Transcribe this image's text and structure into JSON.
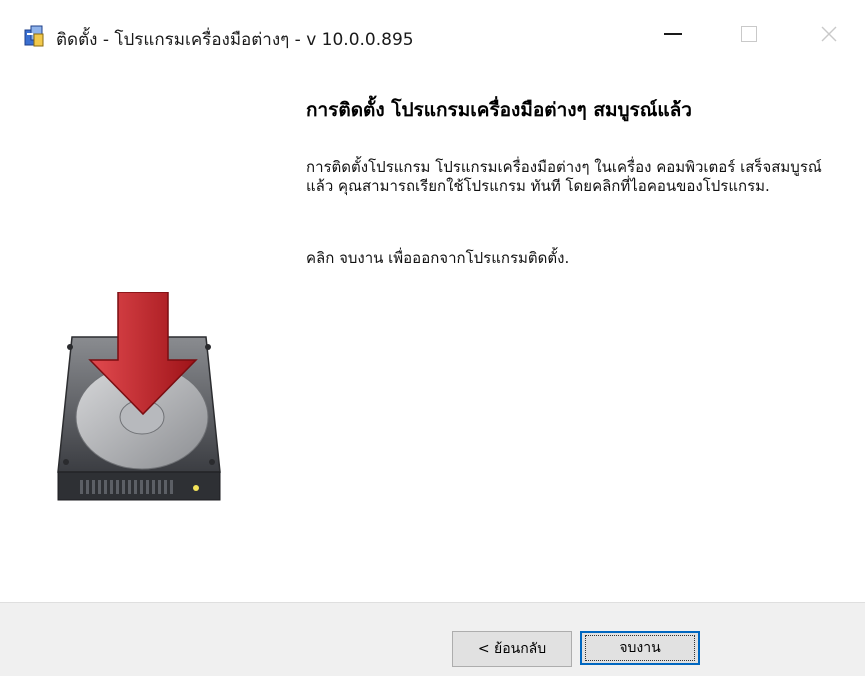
{
  "window": {
    "title": "ติดตั้ง - โปรแกรมเครื่องมือต่างๆ - v 10.0.0.895",
    "controls": {
      "minimize_icon": "minimize-icon",
      "maximize_icon": "maximize-icon",
      "close_icon": "close-icon"
    }
  },
  "main": {
    "heading": "การติดตั้ง โปรแกรมเครื่องมือต่างๆ สมบูรณ์แล้ว",
    "paragraph1": "การติดตั้งโปรแกรม โปรแกรมเครื่องมือต่างๆ ในเครื่อง คอมพิวเตอร์ เสร็จสมบูรณ์ แล้ว คุณสามารถเรียกใช้โปรแกรม ทันที โดยคลิกที่ไอคอนของโปรแกรม.",
    "paragraph2": "คลิก จบงาน เพื่อออกจากโปรแกรมติดตั้ง."
  },
  "footer": {
    "back_label": "< ย้อนกลับ",
    "finish_label": "จบงาน"
  },
  "colors": {
    "accent": "#0067c0",
    "arrow_red": "#c8262b",
    "footer_bg": "#f0f0f0"
  }
}
